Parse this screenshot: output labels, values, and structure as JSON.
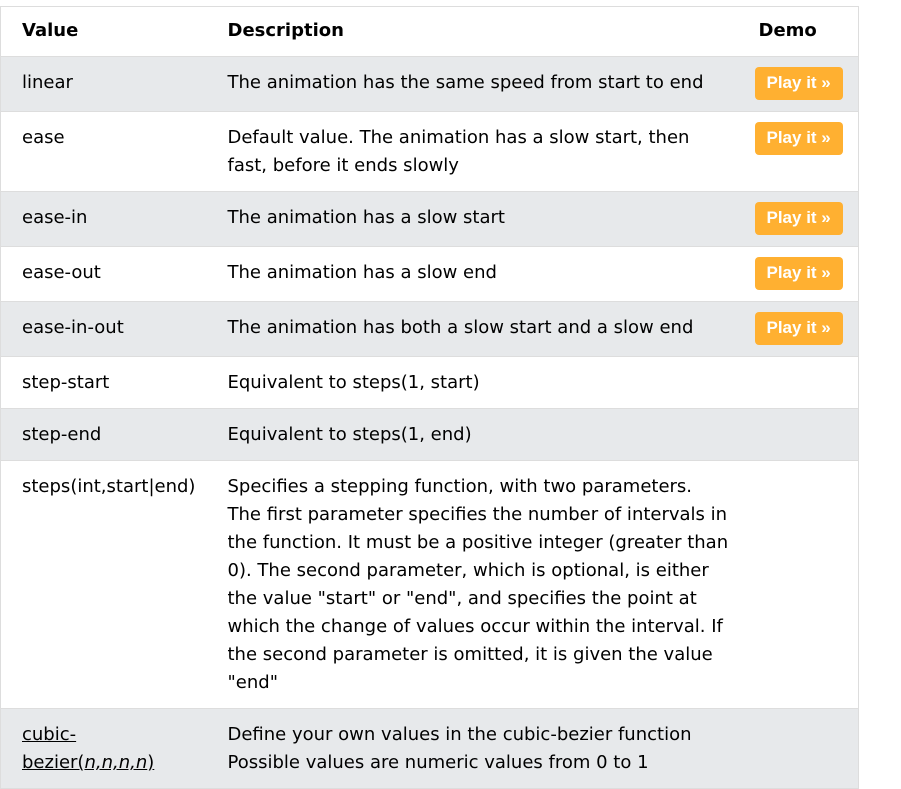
{
  "table": {
    "headers": {
      "value": "Value",
      "description": "Description",
      "demo": "Demo"
    },
    "play_label": "Play it »",
    "rows": [
      {
        "value": "linear",
        "description": "The animation has the same speed from start to end",
        "has_demo": true
      },
      {
        "value": "ease",
        "description": "Default value. The animation has a slow start, then fast, before it ends slowly",
        "has_demo": true
      },
      {
        "value": "ease-in",
        "description": "The animation has a slow start",
        "has_demo": true
      },
      {
        "value": "ease-out",
        "description": "The animation has a slow end",
        "has_demo": true
      },
      {
        "value": "ease-in-out",
        "description": "The animation has both a slow start and a slow end",
        "has_demo": true
      },
      {
        "value": "step-start",
        "description": "Equivalent to steps(1, start)",
        "has_demo": false
      },
      {
        "value": "step-end",
        "description": "Equivalent to steps(1, end)",
        "has_demo": false
      },
      {
        "value": "steps(int,start|end)",
        "description": "Specifies a stepping function, with two parameters. The first parameter specifies the number of intervals in the function. It must be a positive integer (greater than 0). The second parameter, which is optional, is either the value \"start\" or \"end\", and specifies the point at which the change of values occur within the interval. If the second parameter is omitted, it is given the value \"end\"",
        "has_demo": false
      },
      {
        "value_prefix": "cubic-bezier(",
        "value_args": "n,n,n,n",
        "value_suffix": ")",
        "description": "Define your own values in the cubic-bezier function Possible values are numeric values from 0 to 1",
        "has_demo": false
      }
    ]
  }
}
